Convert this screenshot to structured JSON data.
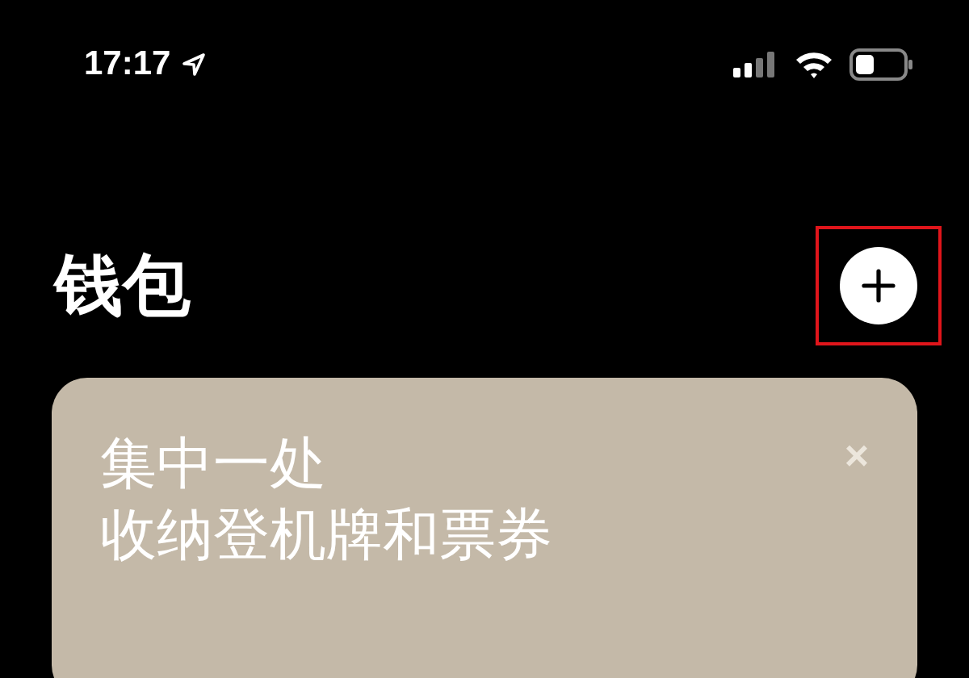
{
  "status_bar": {
    "time": "17:17"
  },
  "header": {
    "title": "钱包",
    "add_highlighted": true
  },
  "card": {
    "lines": [
      "集中一处",
      "收纳登机牌和票券"
    ],
    "close": "×"
  }
}
